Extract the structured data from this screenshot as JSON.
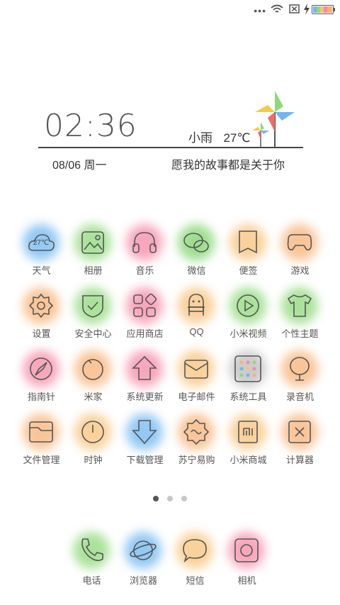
{
  "status_bar": {
    "icons": [
      "more-dots-icon",
      "wifi-icon",
      "no-sim-icon",
      "charging-icon",
      "battery-icon"
    ]
  },
  "widget": {
    "time": "02:36",
    "weather_text": "小雨",
    "temperature": "27℃",
    "date": "08/06 周一",
    "motto": "愿我的故事都是关于你"
  },
  "apps": [
    {
      "label": "天气",
      "icon": "weather-cloud-icon",
      "badge": "27℃",
      "color": "#6fb7f0"
    },
    {
      "label": "相册",
      "icon": "gallery-icon",
      "color": "#8fd97a"
    },
    {
      "label": "音乐",
      "icon": "headphones-icon",
      "color": "#f58aa6"
    },
    {
      "label": "微信",
      "icon": "wechat-icon",
      "color": "#7fd46b"
    },
    {
      "label": "便签",
      "icon": "notes-icon",
      "color": "#f7c27a"
    },
    {
      "label": "游戏",
      "icon": "gamepad-icon",
      "color": "#f7b276"
    },
    {
      "label": "设置",
      "icon": "settings-gear-icon",
      "color": "#f7b276"
    },
    {
      "label": "安全中心",
      "icon": "shield-check-icon",
      "color": "#8fd97a"
    },
    {
      "label": "应用商店",
      "icon": "app-store-icon",
      "color": "#f58aa6"
    },
    {
      "label": "QQ",
      "icon": "qq-penguin-icon",
      "color": "#f7c27a"
    },
    {
      "label": "小米视频",
      "icon": "video-play-icon",
      "color": "#8fd97a"
    },
    {
      "label": "个性主题",
      "icon": "theme-shirt-icon",
      "color": "#8fd97a"
    },
    {
      "label": "指南针",
      "icon": "compass-icon",
      "color": "#f58aa6"
    },
    {
      "label": "米家",
      "icon": "mijia-icon",
      "color": "#f7b276"
    },
    {
      "label": "系统更新",
      "icon": "update-arrow-icon",
      "color": "#f58aa6"
    },
    {
      "label": "电子邮件",
      "icon": "mail-icon",
      "color": "#f7c27a"
    },
    {
      "label": "系统工具",
      "icon": "tools-grid-icon",
      "color": "#bbbbbb"
    },
    {
      "label": "录音机",
      "icon": "recorder-icon",
      "color": "#f7b276"
    },
    {
      "label": "文件管理",
      "icon": "folder-icon",
      "color": "#f7b276"
    },
    {
      "label": "时钟",
      "icon": "clock-icon",
      "color": "#f7c27a"
    },
    {
      "label": "下载管理",
      "icon": "download-arrow-icon",
      "color": "#6fb7f0"
    },
    {
      "label": "苏宁易购",
      "icon": "suning-icon",
      "color": "#f7b276"
    },
    {
      "label": "小米商城",
      "icon": "mi-store-icon",
      "color": "#f7c27a"
    },
    {
      "label": "计算器",
      "icon": "calculator-icon",
      "color": "#f7b276"
    }
  ],
  "pager": {
    "pages": 3,
    "current": 1
  },
  "dock": [
    {
      "label": "电话",
      "icon": "phone-icon",
      "color": "#8fd97a"
    },
    {
      "label": "浏览器",
      "icon": "browser-planet-icon",
      "color": "#6fb7f0"
    },
    {
      "label": "短信",
      "icon": "message-bubble-icon",
      "color": "#f7c27a"
    },
    {
      "label": "相机",
      "icon": "camera-icon",
      "color": "#f58aa6"
    }
  ]
}
